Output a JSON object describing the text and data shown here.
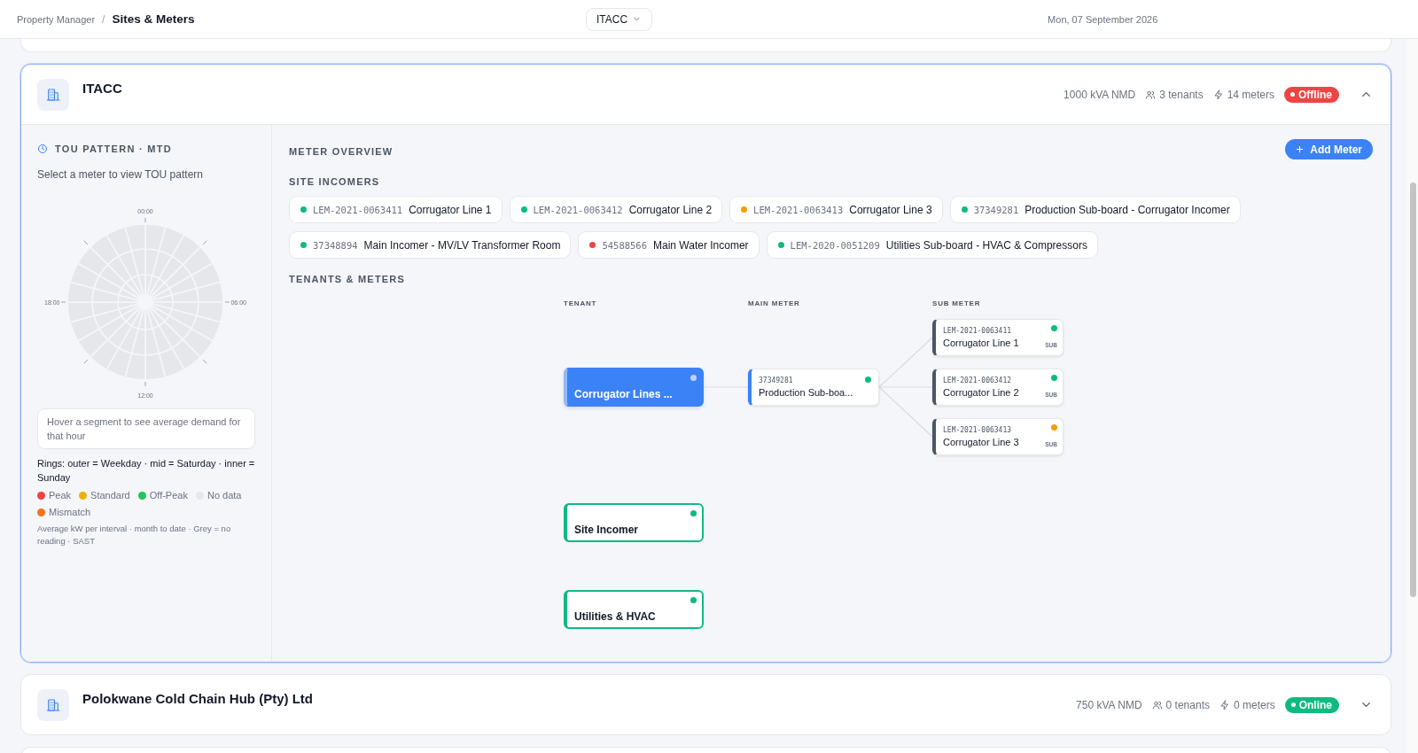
{
  "breadcrumb": {
    "parent": "Property Manager",
    "separator": "/",
    "current": "Sites & Meters"
  },
  "site_selector": {
    "value": "ITACC"
  },
  "date": "Mon, 07 September 2026",
  "sites": [
    {
      "name": "ITACC",
      "nmd": "1000 kVA NMD",
      "tenants": "3 tenants",
      "meters": "14 meters",
      "status": {
        "kind": "offline",
        "label": "Offline"
      },
      "expanded": true,
      "details": {
        "tou_panel": {
          "title": "TOU PATTERN · MTD",
          "subtitle": "Select a meter to view TOU pattern",
          "dial_labels": [
            "00:00",
            "06:00",
            "12:00",
            "18:00"
          ],
          "hint": "Hover a segment to see average demand for that hour",
          "rings_note": "Rings: outer = Weekday · mid = Saturday · inner = Sunday",
          "legend": [
            {
              "label": "Peak",
              "color": "#ef4444"
            },
            {
              "label": "Standard",
              "color": "#eab308"
            },
            {
              "label": "Off-Peak",
              "color": "#22c55e"
            },
            {
              "label": "No data",
              "color": "#e5e7eb"
            },
            {
              "label": "Mismatch",
              "color": "#f97316"
            }
          ],
          "footnote": "Average kW per interval · month to date · Grey = no reading · SAST"
        },
        "meter_overview": {
          "title": "METER OVERVIEW",
          "add_button": "Add Meter",
          "incomers_title": "SITE INCOMERS",
          "incomers": [
            {
              "id": "LEM-2021-0063411",
              "name": "Corrugator Line 1",
              "color": "#10b981"
            },
            {
              "id": "LEM-2021-0063412",
              "name": "Corrugator Line 2",
              "color": "#10b981"
            },
            {
              "id": "LEM-2021-0063413",
              "name": "Corrugator Line 3",
              "color": "#f59e0b"
            },
            {
              "id": "37349281",
              "name": "Production Sub-board - Corrugator Incomer",
              "color": "#10b981"
            },
            {
              "id": "37348894",
              "name": "Main Incomer - MV/LV Transformer Room",
              "color": "#10b981"
            },
            {
              "id": "54588566",
              "name": "Main Water Incomer",
              "color": "#ef4444"
            },
            {
              "id": "LEM-2020-0051209",
              "name": "Utilities Sub-board - HVAC & Compressors",
              "color": "#10b981"
            }
          ],
          "tenants_title": "TENANTS & METERS",
          "columns": [
            "TENANT",
            "MAIN METER",
            "SUB METER"
          ],
          "tenants": [
            {
              "name": "Corrugator Lines ...",
              "selected": true,
              "color": "#bfd3f7",
              "main_meters": [
                {
                  "id": "37349281",
                  "name": "Production Sub-boa...",
                  "color": "#10b981",
                  "sub_meters": [
                    {
                      "id": "LEM-2021-0063411",
                      "name": "Corrugator Line 1",
                      "color": "#10b981",
                      "tag": "SUB"
                    },
                    {
                      "id": "LEM-2021-0063412",
                      "name": "Corrugator Line 2",
                      "color": "#10b981",
                      "tag": "SUB"
                    },
                    {
                      "id": "LEM-2021-0063413",
                      "name": "Corrugator Line 3",
                      "color": "#f59e0b",
                      "tag": "SUB"
                    }
                  ]
                }
              ]
            },
            {
              "name": "Site Incomer",
              "selected": false,
              "color": "#10b981"
            },
            {
              "name": "Utilities & HVAC",
              "selected": false,
              "color": "#10b981"
            }
          ]
        }
      }
    },
    {
      "name": "Polokwane Cold Chain Hub (Pty) Ltd",
      "nmd": "750 kVA NMD",
      "tenants": "0 tenants",
      "meters": "0 meters",
      "status": {
        "kind": "online",
        "label": "Online"
      },
      "expanded": false
    }
  ]
}
